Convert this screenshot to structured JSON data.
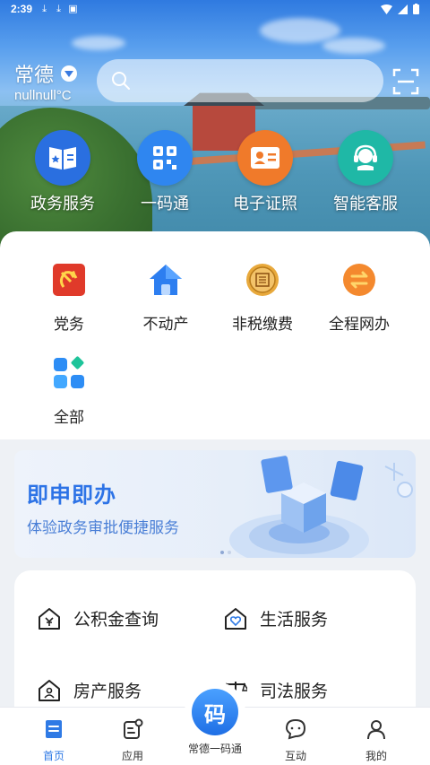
{
  "status_bar": {
    "time": "2:39"
  },
  "header": {
    "city": "常德",
    "temperature": "nullnull°C",
    "search_placeholder": ""
  },
  "quick_actions": [
    {
      "label": "政务服务",
      "icon": "government-service-icon",
      "color": "#2a6fe0"
    },
    {
      "label": "一码通",
      "icon": "qr-code-icon",
      "color": "#2f86f0"
    },
    {
      "label": "电子证照",
      "icon": "id-card-icon",
      "color": "#f07a2a"
    },
    {
      "label": "智能客服",
      "icon": "customer-service-headset-icon",
      "color": "#1fb8a6"
    }
  ],
  "services": [
    {
      "label": "党务",
      "icon": "party-emblem-icon"
    },
    {
      "label": "不动产",
      "icon": "house-icon"
    },
    {
      "label": "非税缴费",
      "icon": "seal-coin-icon"
    },
    {
      "label": "全程网办",
      "icon": "online-process-icon"
    },
    {
      "label": "全部",
      "icon": "all-apps-icon"
    }
  ],
  "banner": {
    "title": "即申即办",
    "subtitle": "体验政务审批便捷服务"
  },
  "list_items": [
    {
      "label": "公积金查询",
      "icon": "housing-fund-icon"
    },
    {
      "label": "生活服务",
      "icon": "life-service-icon"
    },
    {
      "label": "房产服务",
      "icon": "property-icon"
    },
    {
      "label": "司法服务",
      "icon": "justice-scale-icon"
    }
  ],
  "bottom_nav": {
    "home": "首页",
    "apps": "应用",
    "center": "常德一码通",
    "center_glyph": "码",
    "interact": "互动",
    "mine": "我的"
  },
  "colors": {
    "accent": "#2f7ae5",
    "banner_title": "#2d73e6"
  }
}
